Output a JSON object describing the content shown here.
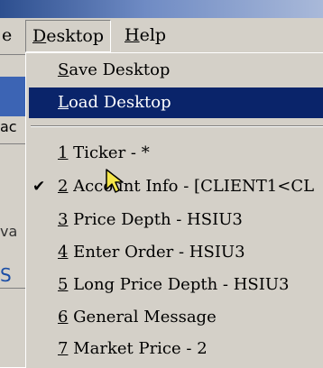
{
  "menubar": {
    "partial_item": "e",
    "items": [
      {
        "label": "Desktop",
        "underline": "D",
        "rest": "esktop"
      },
      {
        "label": "Help",
        "underline": "H",
        "rest": "elp"
      }
    ]
  },
  "background": {
    "fragment1": "ac",
    "fragment2": "va",
    "fragment3": "S"
  },
  "menu": {
    "save_desktop": {
      "underline": "S",
      "rest": "ave Desktop"
    },
    "load_desktop": {
      "underline": "L",
      "rest": "oad Desktop"
    },
    "windows": [
      {
        "num": "1",
        "text": " Ticker - *",
        "checked": false
      },
      {
        "num": "2",
        "text": " Account Info - [CLIENT1<CL",
        "checked": true
      },
      {
        "num": "3",
        "text": " Price Depth - HSIU3",
        "checked": false
      },
      {
        "num": "4",
        "text": " Enter Order - HSIU3",
        "checked": false
      },
      {
        "num": "5",
        "text": " Long Price Depth - HSIU3",
        "checked": false
      },
      {
        "num": "6",
        "text": " General Message",
        "checked": false
      },
      {
        "num": "7",
        "text": " Market Price - 2",
        "checked": false
      }
    ],
    "check_glyph": "✔"
  },
  "colors": {
    "menu_bg": "#d4d0c8",
    "highlight": "#0a246a",
    "highlight_text": "#ffffff"
  }
}
